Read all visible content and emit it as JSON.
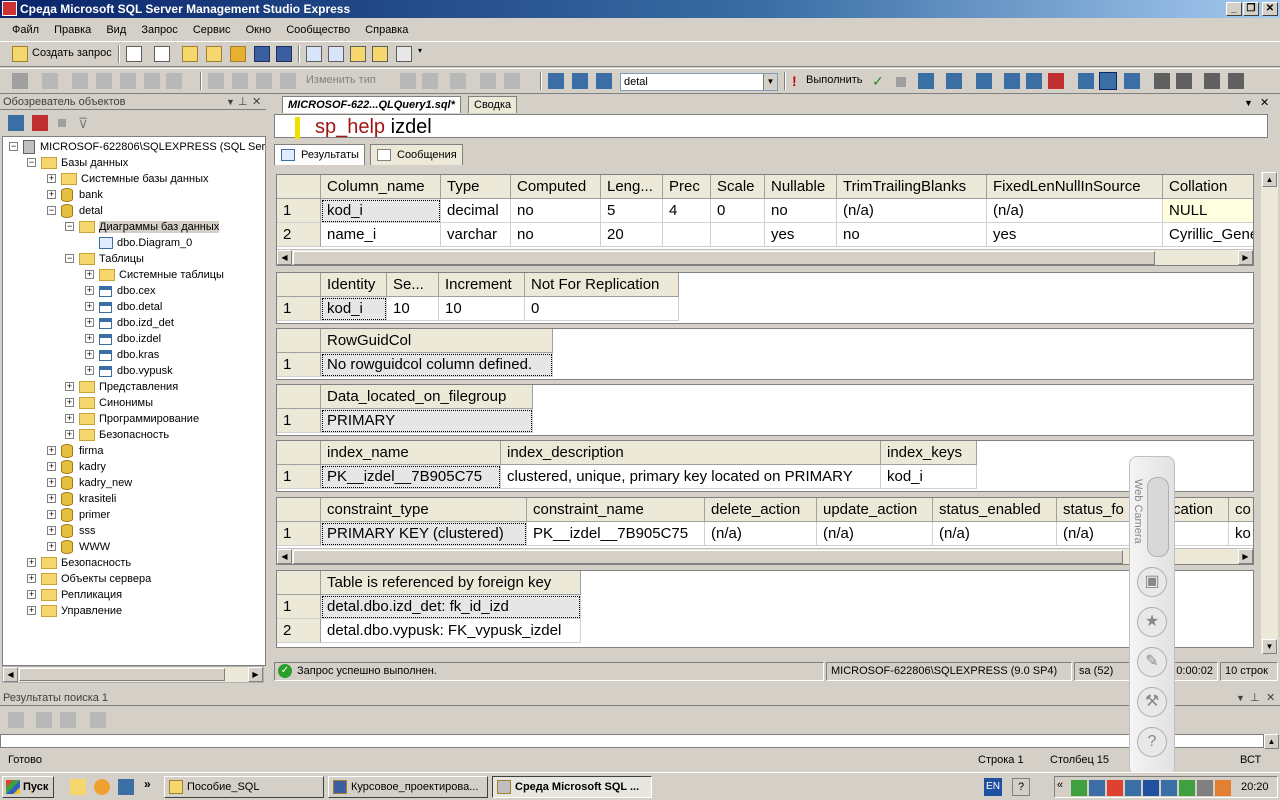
{
  "window": {
    "title": "Среда Microsoft SQL Server Management Studio Express"
  },
  "menu": [
    "Файл",
    "Правка",
    "Вид",
    "Запрос",
    "Окно",
    "Сообщество",
    "Справка"
  ],
  "menu_row2": [
    "Сервис",
    "Окно",
    "Сообщество",
    "Справка"
  ],
  "toolbar1": {
    "new_query": "Создать запрос"
  },
  "toolbar2": {
    "change_type": "Изменить тип",
    "database": "detal",
    "execute": "Выполнить"
  },
  "object_explorer": {
    "title": "Обозреватель объектов",
    "server": "MICROSOF-622806\\SQLEXPRESS (SQL Server",
    "items": {
      "databases": "Базы данных",
      "system_dbs": "Системные базы данных",
      "bank": "bank",
      "detal": "detal",
      "diagrams": "Диаграммы баз данных",
      "diagram0": "dbo.Diagram_0",
      "tables": "Таблицы",
      "system_tables": "Системные таблицы",
      "t_cex": "dbo.cex",
      "t_detal": "dbo.detal",
      "t_izd_det": "dbo.izd_det",
      "t_izdel": "dbo.izdel",
      "t_kras": "dbo.kras",
      "t_vypusk": "dbo.vypusk",
      "views": "Представления",
      "synonyms": "Синонимы",
      "programming": "Программирование",
      "security_db": "Безопасность",
      "firma": "firma",
      "kadry": "kadry",
      "kadry_new": "kadry_new",
      "krasiteli": "krasiteli",
      "primer": "primer",
      "sss": "sss",
      "www": "WWW",
      "security": "Безопасность",
      "server_objects": "Объекты сервера",
      "replication": "Репликация",
      "management": "Управление"
    }
  },
  "document": {
    "tab_query": "MICROSOF-622...QLQuery1.sql*",
    "tab_summary": "Сводка",
    "query_keyword": "sp_help",
    "query_arg": " izdel",
    "results_tab": "Результаты",
    "messages_tab": "Сообщения"
  },
  "grid1": {
    "headers": [
      "Column_name",
      "Type",
      "Computed",
      "Leng...",
      "Prec",
      "Scale",
      "Nullable",
      "TrimTrailingBlanks",
      "FixedLenNullInSource",
      "Collation"
    ],
    "rows": [
      [
        "1",
        "kod_i",
        "decimal",
        "no",
        "5",
        "4",
        "0",
        "no",
        "(n/a)",
        "(n/a)",
        "NULL"
      ],
      [
        "2",
        "name_i",
        "varchar",
        "no",
        "20",
        "",
        "",
        "yes",
        "no",
        "yes",
        "Cyrillic_General"
      ]
    ]
  },
  "grid2": {
    "headers": [
      "Identity",
      "Se...",
      "Increment",
      "Not For Replication"
    ],
    "rows": [
      [
        "1",
        "kod_i",
        "10",
        "10",
        "0"
      ]
    ]
  },
  "grid3": {
    "headers": [
      "RowGuidCol"
    ],
    "rows": [
      [
        "1",
        "No rowguidcol column defined."
      ]
    ]
  },
  "grid4": {
    "headers": [
      "Data_located_on_filegroup"
    ],
    "rows": [
      [
        "1",
        "PRIMARY"
      ]
    ]
  },
  "grid5": {
    "headers": [
      "index_name",
      "index_description",
      "index_keys"
    ],
    "rows": [
      [
        "1",
        "PK__izdel__7B905C75",
        "clustered, unique, primary key located on PRIMARY",
        "kod_i"
      ]
    ]
  },
  "grid6": {
    "headers": [
      "constraint_type",
      "constraint_name",
      "delete_action",
      "update_action",
      "status_enabled",
      "status_fo",
      "cation",
      "co"
    ],
    "rows": [
      [
        "1",
        "PRIMARY KEY (clustered)",
        "PK__izdel__7B905C75",
        "(n/a)",
        "(n/a)",
        "(n/a)",
        "(n/a)",
        "",
        "ko"
      ]
    ]
  },
  "grid7": {
    "headers": [
      "Table is referenced by foreign key"
    ],
    "rows": [
      [
        "1",
        "detal.dbo.izd_det: fk_id_izd"
      ],
      [
        "2",
        "detal.dbo.vypusk: FK_vypusk_izdel"
      ]
    ]
  },
  "query_status": {
    "message": "Запрос успешно выполнен.",
    "server": "MICROSOF-622806\\SQLEXPRESS (9.0 SP4)",
    "user": "sa (52)",
    "time": "0:00:02",
    "rows": "10 строк"
  },
  "search_results": {
    "title": "Результаты поиска 1"
  },
  "statusbar": {
    "ready": "Готово",
    "line": "Строка 1",
    "col": "Столбец 15",
    "mode": "ВСТ"
  },
  "webcam": {
    "label": "Web Camera"
  },
  "taskbar": {
    "start": "Пуск",
    "items": [
      "Пособие_SQL",
      "Курсовое_проектирова...",
      "Среда Microsoft SQL ..."
    ],
    "lang": "EN",
    "clock": "20:20"
  },
  "colors": {
    "title_start": "#0a246a",
    "title_end": "#a6caf0",
    "keyword": "#a31515",
    "highlight": "#f0e000"
  }
}
